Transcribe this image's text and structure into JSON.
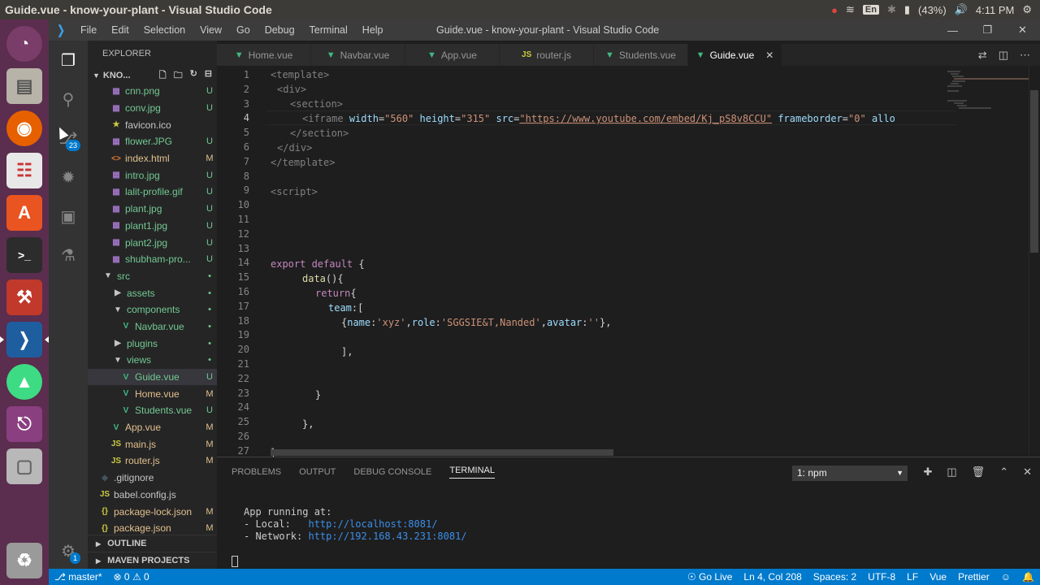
{
  "window": {
    "title": "Guide.vue - know-your-plant - Visual Studio Code"
  },
  "tray": {
    "battery": "(43%)",
    "time": "4:11 PM",
    "lang": "En"
  },
  "menu": {
    "items": [
      "File",
      "Edit",
      "Selection",
      "View",
      "Go",
      "Debug",
      "Terminal",
      "Help"
    ],
    "title": "Guide.vue - know-your-plant - Visual Studio Code"
  },
  "activity": {
    "scm_badge": "23",
    "settings_badge": "1"
  },
  "explorer": {
    "header": "EXPLORER",
    "folder": "KNO...",
    "files": [
      {
        "name": "cnn.png",
        "status": "U",
        "type": "img"
      },
      {
        "name": "conv.jpg",
        "status": "U",
        "type": "img"
      },
      {
        "name": "favicon.ico",
        "status": "",
        "type": "star"
      },
      {
        "name": "flower.JPG",
        "status": "U",
        "type": "img"
      },
      {
        "name": "index.html",
        "status": "M",
        "type": "html"
      },
      {
        "name": "intro.jpg",
        "status": "U",
        "type": "img"
      },
      {
        "name": "lalit-profile.gif",
        "status": "U",
        "type": "img"
      },
      {
        "name": "plant.jpg",
        "status": "U",
        "type": "img"
      },
      {
        "name": "plant1.jpg",
        "status": "U",
        "type": "img"
      },
      {
        "name": "plant2.jpg",
        "status": "U",
        "type": "img"
      },
      {
        "name": "shubham-pro...",
        "status": "U",
        "type": "img"
      },
      {
        "name": "src",
        "status": "•",
        "type": "folder"
      },
      {
        "name": "assets",
        "status": "•",
        "type": "folder-c"
      },
      {
        "name": "components",
        "status": "•",
        "type": "folder"
      },
      {
        "name": "Navbar.vue",
        "status": "•",
        "type": "vue"
      },
      {
        "name": "plugins",
        "status": "•",
        "type": "folder-c"
      },
      {
        "name": "views",
        "status": "•",
        "type": "folder"
      },
      {
        "name": "Guide.vue",
        "status": "U",
        "type": "vue"
      },
      {
        "name": "Home.vue",
        "status": "M",
        "type": "vue"
      },
      {
        "name": "Students.vue",
        "status": "U",
        "type": "vue"
      },
      {
        "name": "App.vue",
        "status": "M",
        "type": "vue"
      },
      {
        "name": "main.js",
        "status": "M",
        "type": "js"
      },
      {
        "name": "router.js",
        "status": "M",
        "type": "js"
      },
      {
        "name": ".gitignore",
        "status": "",
        "type": "git"
      },
      {
        "name": "babel.config.js",
        "status": "",
        "type": "js"
      },
      {
        "name": "package-lock.json",
        "status": "M",
        "type": "json"
      },
      {
        "name": "package.json",
        "status": "M",
        "type": "json"
      }
    ],
    "outline": "OUTLINE",
    "maven": "MAVEN PROJECTS"
  },
  "tabs": [
    {
      "label": "Home.vue",
      "icon": "vue"
    },
    {
      "label": "Navbar.vue",
      "icon": "vue"
    },
    {
      "label": "App.vue",
      "icon": "vue"
    },
    {
      "label": "router.js",
      "icon": "js"
    },
    {
      "label": "Students.vue",
      "icon": "vue"
    },
    {
      "label": "Guide.vue",
      "icon": "vue",
      "active": true
    }
  ],
  "code": {
    "line_numbers": [
      "1",
      "2",
      "3",
      "4",
      "5",
      "6",
      "7",
      "8",
      "9",
      "10",
      "11",
      "12",
      "13",
      "14",
      "15",
      "16",
      "17",
      "18",
      "19",
      "20",
      "21",
      "22",
      "23",
      "24",
      "25",
      "26",
      "27"
    ],
    "l1": "<template>",
    "l2": "<div>",
    "l3": "<section>",
    "l4_tag": "<iframe",
    "l4_a1": "width",
    "l4_v1": "\"560\"",
    "l4_a2": "height",
    "l4_v2": "\"315\"",
    "l4_a3": "src",
    "l4_url": "\"https://www.youtube.com/embed/Kj_pS8v8CCU\"",
    "l4_a4": "frameborder",
    "l4_v4": "\"0\"",
    "l4_a5": "allo",
    "l5": "</section>",
    "l6": "</div>",
    "l7": "</template>",
    "l9": "<script>",
    "l14_kw": "export default",
    "l14_p": "{",
    "l15_fn": "data",
    "l15_p": "(){",
    "l16_kw": "return",
    "l16_p": "{",
    "l17_key": "team",
    "l17_p": ":[",
    "l18_p1": "{",
    "l18_k1": "name",
    "l18_v1": "'xyz'",
    "l18_k2": "role",
    "l18_v2": "'SGGSIE&T,Nanded'",
    "l18_k3": "avatar",
    "l18_v3": "''",
    "l18_p2": "},",
    "l20": "],",
    "l23": "}",
    "l25": "},",
    "l27": "}"
  },
  "panel": {
    "tabs": [
      "PROBLEMS",
      "OUTPUT",
      "DEBUG CONSOLE",
      "TERMINAL"
    ],
    "terminal_select": "1: npm",
    "term_line1": "App running at:",
    "term_local_label": "- Local:   ",
    "term_local_url": "http://localhost:8081/",
    "term_net_label": "- Network: ",
    "term_net_url": "http://192.168.43.231:8081/"
  },
  "status": {
    "branch": "master*",
    "errors": "0",
    "warnings": "0",
    "golive": "Go Live",
    "position": "Ln 4, Col 208",
    "spaces": "Spaces: 2",
    "encoding": "UTF-8",
    "eol": "LF",
    "language": "Vue",
    "formatter": "Prettier"
  },
  "colors": {
    "accent": "#007acc",
    "launcher": "#5b2d4e",
    "vue": "#41b883"
  }
}
